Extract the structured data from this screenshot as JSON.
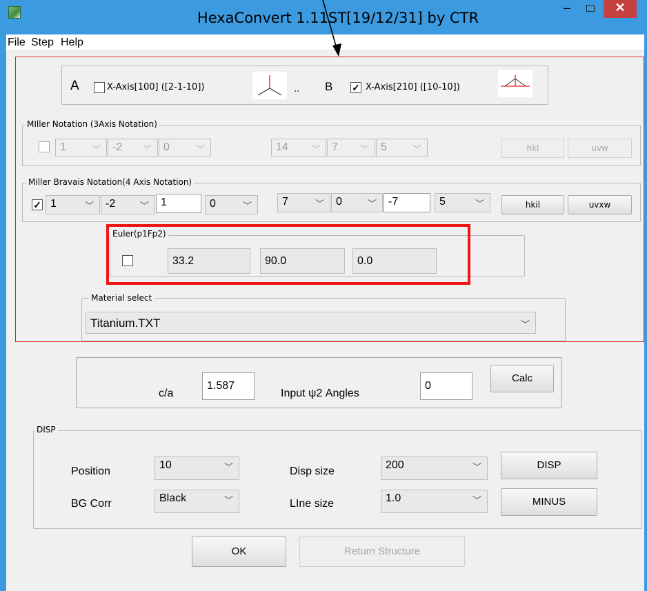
{
  "window": {
    "title": "HexaConvert 1.11ST[19/12/31] by CTR",
    "minimize": "–",
    "close": "✕"
  },
  "menu": [
    "File",
    "Step",
    "Help"
  ],
  "axes": {
    "a_letter": "A",
    "a_label": "X-Axis[100] ([2-1-10])",
    "a_checked": false,
    "dots": "..",
    "b_letter": "B",
    "b_label": "X-Axis[210] ([10-10])",
    "b_checked": true
  },
  "miller": {
    "legend": "MIller Notation (3Axis Notation)",
    "checked": false,
    "values": [
      "1",
      "-2",
      "0",
      "14",
      "7",
      "5"
    ],
    "hkl_button": "hkl",
    "uvw_button": "uvw"
  },
  "miller_bravais": {
    "legend": "Miller Bravais Notation(4 Axis Notation)",
    "checked": true,
    "hkil": [
      "1",
      "-2",
      "1",
      "0"
    ],
    "uvtw": [
      "7",
      "0",
      "-7",
      "5"
    ],
    "hkil_button": "hkil",
    "uvxw_button": "uvxw"
  },
  "euler": {
    "legend": "Euler(p1Fp2)",
    "checked": false,
    "values": [
      "33.2",
      "90.0",
      "0.0"
    ]
  },
  "material": {
    "legend": "Material select",
    "selected": "Titanium.TXT"
  },
  "calc_panel": {
    "ca_label": "c/a",
    "ca_value": "1.587",
    "psi_label": "Input ψ2 Angles",
    "psi_value": "0",
    "calc_button": "Calc"
  },
  "disp": {
    "legend": "DISP",
    "position_label": "Position",
    "position_value": "10",
    "bg_label": "BG Corr",
    "bg_value": "Black",
    "disp_size_label": "Disp size",
    "disp_size_value": "200",
    "line_size_label": "LIne size",
    "line_size_value": "1.0",
    "disp_button": "DISP",
    "minus_button": "MINUS"
  },
  "footer": {
    "ok_button": "OK",
    "return_button": "Return Structure"
  },
  "colors": {
    "title_bar": "#3c9be0",
    "close_button": "#c74040",
    "annotation_red": "#e02020"
  }
}
